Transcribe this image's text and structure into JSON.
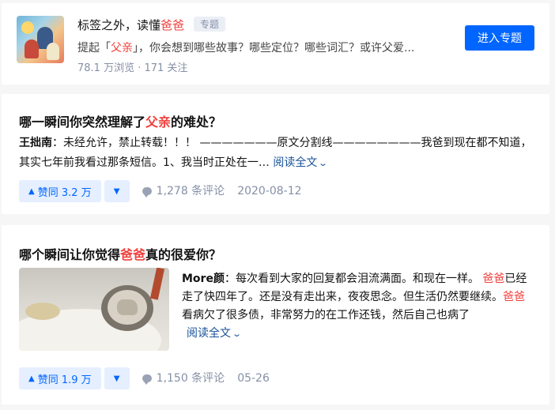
{
  "topic": {
    "title_prefix": "标签之外，读懂",
    "title_highlight": "爸爸",
    "tag": "专题",
    "desc_prefix": "提起「",
    "desc_highlight": "父亲",
    "desc_suffix": "」，你会想到哪些故事？哪些定位？哪些词汇？或许父爱...",
    "stats": "78.1 万浏览 · 171 关注",
    "enter_button": "进入专题"
  },
  "answers": [
    {
      "title_prefix": "哪一瞬间你突然理解了",
      "title_highlight": "父亲",
      "title_suffix": "的难处？",
      "author": "王拙南",
      "excerpt": "：未经允许，禁止转载！！！ ———————原文分割线————————我爸到现在都不知道，其实七年前我看过那条短信。1、我当时正处在一…",
      "read_more": "阅读全文",
      "votes": "赞同 3.2 万",
      "comments": "1,278 条评论",
      "date": "2020-08-12"
    },
    {
      "title_prefix": "哪个瞬间让你觉得",
      "title_highlight": "爸爸",
      "title_suffix": "真的很爱你？",
      "author": "More颜",
      "excerpt_1": "：每次看到大家的回复都会泪流满面。和现在一样。 ",
      "highlight_1": "爸爸",
      "excerpt_2": "已经走了快四年了。还是没有走出来，夜夜思念。但生活仍然要继续。",
      "highlight_2": "爸爸",
      "excerpt_3": "看病欠了很多债，非常努力的在工作还钱，然后自己也病了",
      "read_more": "阅读全文",
      "votes": "赞同 1.9 万",
      "comments": "1,150 条评论",
      "date": "05-26"
    }
  ],
  "colors": {
    "primary": "#0066ff",
    "highlight": "#f1403c",
    "link": "#175199",
    "meta": "#8590a6"
  }
}
